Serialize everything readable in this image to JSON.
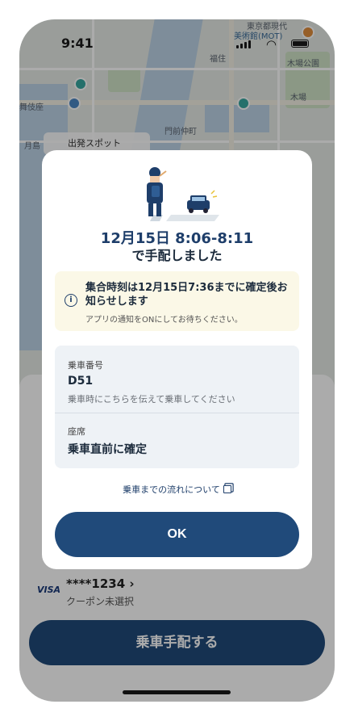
{
  "status": {
    "time": "9:41"
  },
  "map": {
    "labels": [
      "東京都現代",
      "美術館(MOT)",
      "木場公園",
      "舞伎座",
      "月島",
      "木場",
      "福住",
      "門前仲町"
    ],
    "spot_label": "出発スポット"
  },
  "modal": {
    "time_line": "12月15日 8:06-8:11",
    "done_line": "で手配しました",
    "notice": {
      "title": "集合時刻は12月15日7:36までに確定後お知らせします",
      "subtitle": "アプリの通知をONにしてお待ちください。"
    },
    "ride_number": {
      "label": "乗車番号",
      "value": "D51",
      "hint": "乗車時にこちらを伝えて乗車してください"
    },
    "seat": {
      "label": "座席",
      "value": "乗車直前に確定"
    },
    "flow_link": "乗車までの流れについて",
    "ok_label": "OK"
  },
  "sheet": {
    "card_brand": "VISA",
    "card_number": "****1234 ›",
    "coupon": "クーポン未選択",
    "request_button": "乗車手配する"
  },
  "colors": {
    "primary": "#204a7a",
    "notice_bg": "#fbf8e7",
    "info_bg": "#eef2f6"
  }
}
